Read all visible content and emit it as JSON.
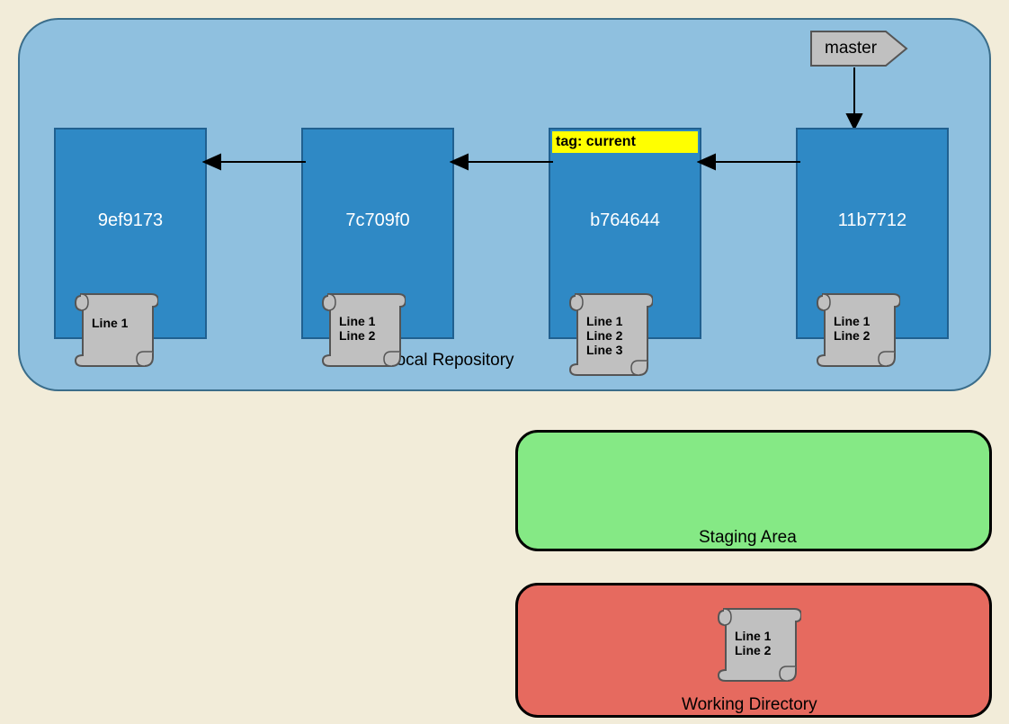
{
  "localRepo": {
    "label": "Local Repository"
  },
  "commits": [
    {
      "hash": "9ef9173",
      "scroll": "Line 1"
    },
    {
      "hash": "7c709f0",
      "scroll": "Line 1\nLine 2"
    },
    {
      "hash": "b764644",
      "scroll": "Line 1\nLine 2\nLine 3",
      "tag": "tag: current"
    },
    {
      "hash": "11b7712",
      "scroll": "Line 1\nLine 2"
    }
  ],
  "branch": {
    "name": "master"
  },
  "staging": {
    "label": "Staging Area"
  },
  "working": {
    "label": "Working Directory",
    "scroll": "Line 1\nLine 2"
  }
}
